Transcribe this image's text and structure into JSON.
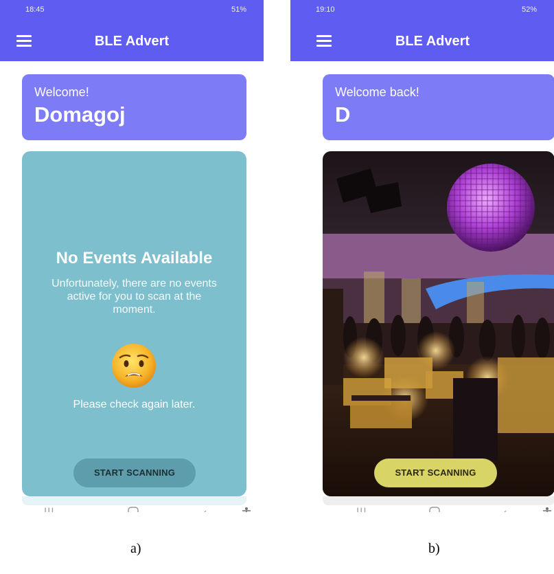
{
  "screens": [
    {
      "status_time": "18:45",
      "status_right": "51%",
      "app_title": "BLE Advert",
      "welcome_label": "Welcome!",
      "user_name": "Domagoj",
      "no_events_title": "No Events Available",
      "no_events_text": "Unfortunately, there are no events active for you to scan at the moment.",
      "emoji_icon": "worried-face-icon",
      "check_later_text": "Please check again later.",
      "scan_button": "START SCANNING",
      "card_color": "#7dbfcd",
      "caption": "a)"
    },
    {
      "status_time": "19:10",
      "status_right": "52%",
      "app_title": "BLE Advert",
      "welcome_label": "Welcome back!",
      "user_name": "D",
      "event_image": "disco-party-venue-photo",
      "scan_button": "START SCANNING",
      "button_color": "#d8d465",
      "caption": "b)"
    }
  ],
  "theme": {
    "app_bar_color": "#5f5cf1",
    "welcome_card_color": "#7d7bf6"
  },
  "nav_icons": [
    "recents-icon",
    "home-icon",
    "back-icon",
    "accessibility-icon"
  ]
}
